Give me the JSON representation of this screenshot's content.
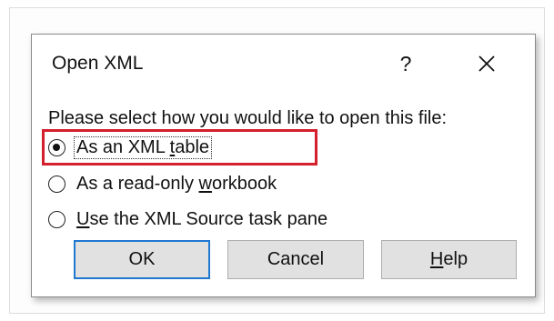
{
  "dialog": {
    "title": "Open XML",
    "help_symbol": "?",
    "prompt": "Please select how you would like to open this file:",
    "options": [
      {
        "label": "As an XML table",
        "selected": true
      },
      {
        "label": "As a read-only workbook",
        "selected": false
      },
      {
        "label": "Use the XML Source task pane",
        "selected": false
      }
    ],
    "buttons": {
      "ok": "OK",
      "cancel": "Cancel",
      "help": "Help"
    }
  },
  "colors": {
    "highlight": "#d4202c",
    "default_button_border": "#1f78d1",
    "button_face": "#e1e1e1"
  }
}
